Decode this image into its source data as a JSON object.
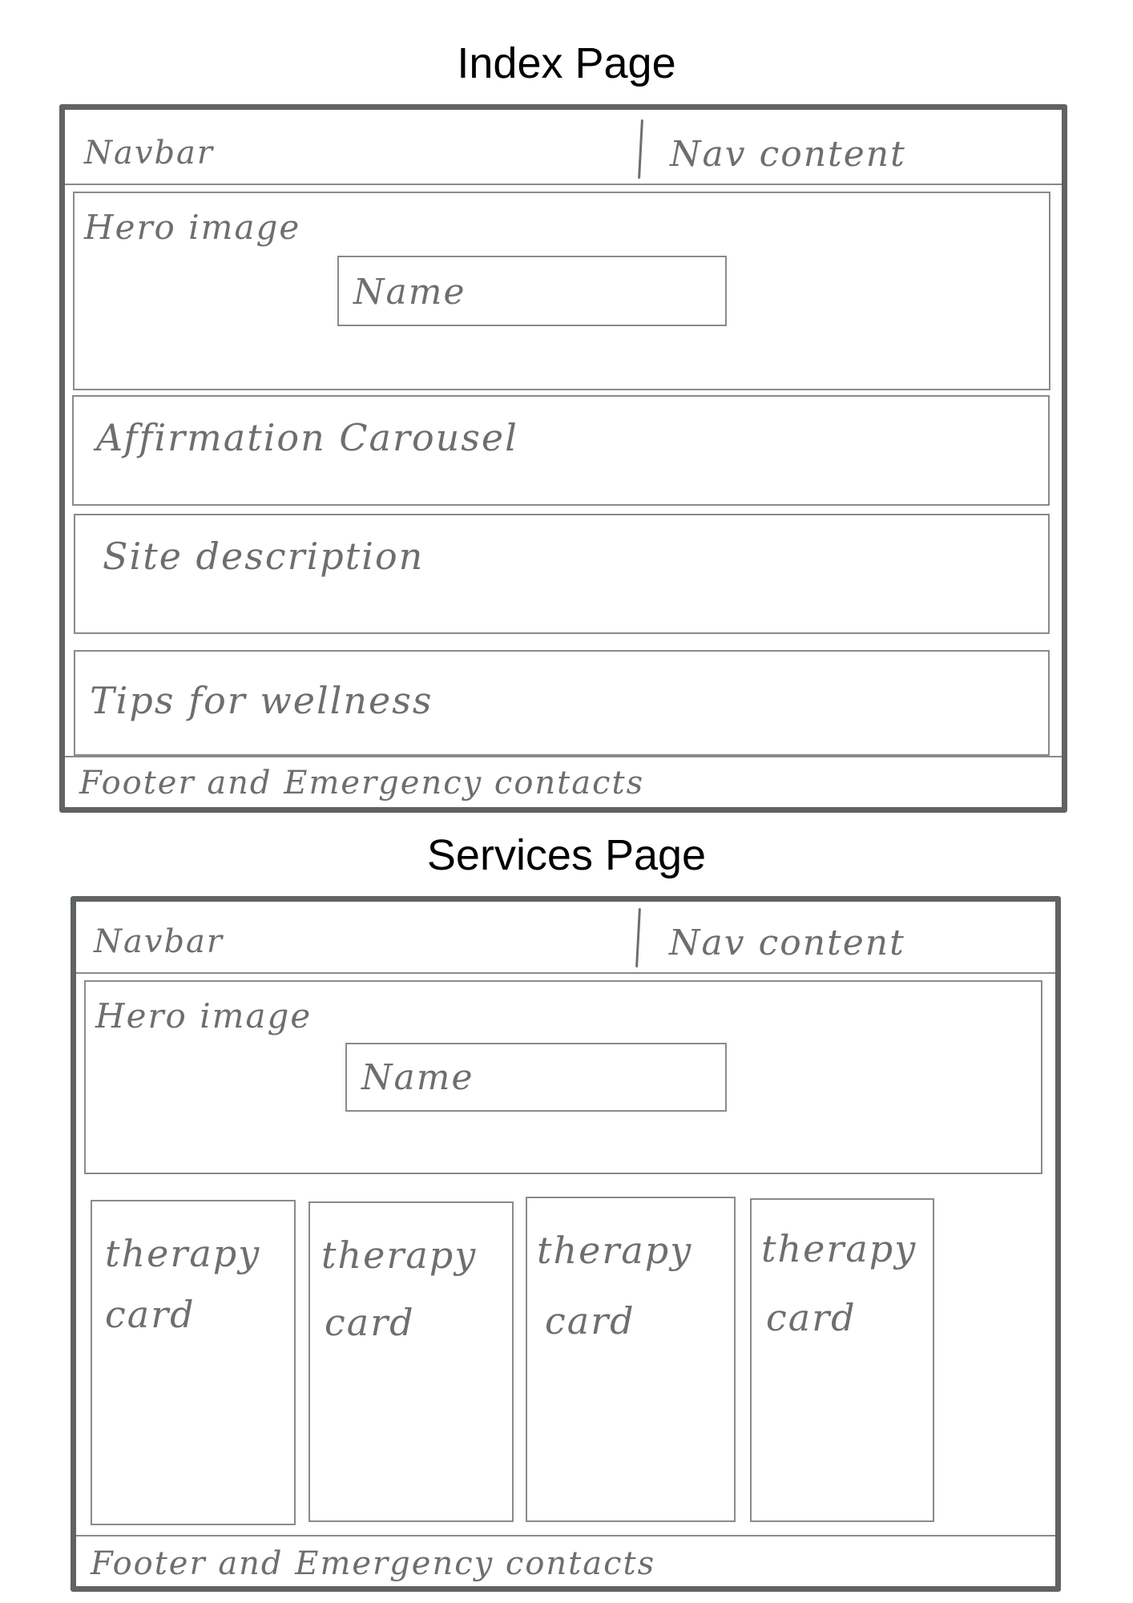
{
  "index_page": {
    "title": "Index Page",
    "navbar_label": "Navbar",
    "nav_content_label": "Nav content",
    "hero_label": "Hero image",
    "name_label": "Name",
    "affirmation_label": "Affirmation Carousel",
    "site_description_label": "Site description",
    "tips_label": "Tips for wellness",
    "footer_label": "Footer and Emergency contacts"
  },
  "services_page": {
    "title": "Services Page",
    "navbar_label": "Navbar",
    "nav_content_label": "Nav content",
    "hero_label": "Hero image",
    "name_label": "Name",
    "cards": [
      {
        "line1": "therapy",
        "line2": "card"
      },
      {
        "line1": "therapy",
        "line2": "card"
      },
      {
        "line1": "therapy",
        "line2": "card"
      },
      {
        "line1": "therapy",
        "line2": "card"
      }
    ],
    "footer_label": "Footer and Emergency contacts"
  }
}
